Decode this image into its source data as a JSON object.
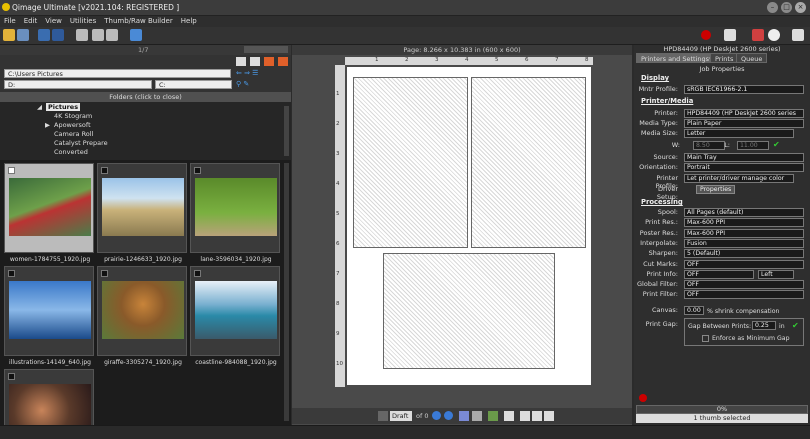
{
  "app": {
    "title": "Qimage Ultimate [v2021.104: REGISTERED ]"
  },
  "menu": [
    "File",
    "Edit",
    "View",
    "Utilities",
    "Thumb/Raw Builder",
    "Help"
  ],
  "left": {
    "page_count": "1/7",
    "path": "C:\\Users                  Pictures",
    "drive": "D:",
    "drive2": "C:",
    "folders_header": "Folders (click to close)",
    "folders": [
      "Pictures",
      "4K Stogram",
      "Apowersoft",
      "Camera Roll",
      "Catalyst Prepare",
      "Converted"
    ],
    "thumbs": [
      {
        "name": "women-1784755_1920.jpg",
        "checked": true
      },
      {
        "name": "prairie-1246633_1920.jpg",
        "checked": false
      },
      {
        "name": "lane-3596034_1920.jpg",
        "checked": false
      },
      {
        "name": "illustrations-14149_640.jpg",
        "checked": false
      },
      {
        "name": "giraffe-3305274_1920.jpg",
        "checked": false
      },
      {
        "name": "coastline-984088_1920.jpg",
        "checked": false
      },
      {
        "name": "",
        "checked": false
      }
    ]
  },
  "center": {
    "page_info": "Page: 8.266 x 10.383 in  (600 x 600)",
    "ruler_top": [
      "1",
      "2",
      "3",
      "4",
      "5",
      "6",
      "7",
      "8"
    ],
    "ruler_left": [
      "1",
      "2",
      "3",
      "4",
      "5",
      "6",
      "7",
      "8",
      "9",
      "10"
    ],
    "bottom": {
      "mode": "Draft",
      "of": "of 0"
    }
  },
  "right": {
    "printer_header": "HPD84409 (HP DeskJet 2600 series)",
    "tabs": [
      "Printers and Settings*",
      "Prints",
      "Queue"
    ],
    "job_properties": "Job Properties",
    "display": {
      "title": "Display",
      "mntr_label": "Mntr Profile:",
      "mntr_value": "sRGB IEC61966-2.1"
    },
    "printer_media": {
      "title": "Printer/Media",
      "printer_label": "Printer:",
      "printer_value": "HPD84409 (HP DeskJet 2600 series",
      "media_type_label": "Media Type:",
      "media_type_value": "Plain Paper",
      "media_size_label": "Media Size:",
      "media_size_value": "Letter",
      "w_label": "W:",
      "w_value": "8.50",
      "l_label": "L:",
      "l_value": "11.00",
      "source_label": "Source:",
      "source_value": "Main Tray",
      "orientation_label": "Orientation:",
      "orientation_value": "Portrait",
      "profile_label": "Printer Profile:",
      "profile_value": "Let printer/driver manage color",
      "driver_label": "Driver Setup:",
      "driver_button": "Properties"
    },
    "processing": {
      "title": "Processing",
      "rows": [
        {
          "label": "Spool:",
          "value": "All Pages (default)"
        },
        {
          "label": "Print Res.:",
          "value": "Max-600 PPI"
        },
        {
          "label": "Poster Res.:",
          "value": "Max-600 PPI"
        },
        {
          "label": "Interpolate:",
          "value": "Fusion"
        },
        {
          "label": "Sharpen:",
          "value": "5 (Default)"
        },
        {
          "label": "Cut Marks:",
          "value": "OFF"
        },
        {
          "label": "Print Info:",
          "value": "OFF"
        },
        {
          "label": "Global Filter:",
          "value": "OFF"
        },
        {
          "label": "Print Filter:",
          "value": "OFF"
        }
      ],
      "print_info_pos": "Left",
      "canvas_label": "Canvas:",
      "canvas_value": "0.00",
      "canvas_suffix": "% shrink compensation",
      "gap_label": "Print Gap:",
      "gap_text": "Gap Between Prints:",
      "gap_value": "0.25",
      "gap_unit": "in",
      "enforce_label": "Enforce as Minimum Gap"
    },
    "progress": "0%",
    "thumb_selected": "1 thumb selected"
  },
  "colors": {
    "accent": "#2f6fd6",
    "check": "#33cc33",
    "folder_bg": "#262626",
    "paper": "#ffffff"
  }
}
